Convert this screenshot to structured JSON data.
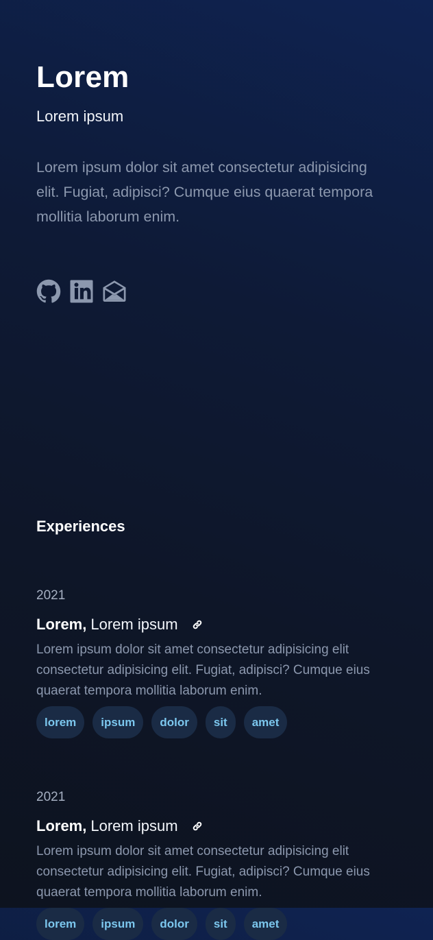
{
  "header": {
    "name": "Lorem",
    "subtitle": "Lorem ipsum",
    "intro": "Lorem ipsum dolor sit amet consectetur adipisicing elit. Fugiat, adipisci? Cumque eius quaerat tempora mollitia laborum enim."
  },
  "socials": [
    {
      "icon": "github-icon"
    },
    {
      "icon": "linkedin-icon"
    },
    {
      "icon": "mail-icon"
    }
  ],
  "colors": {
    "text_muted": "#8c98ae",
    "tag_text": "#7cc7ee",
    "tag_bg": "#1a2b45"
  },
  "experiences": {
    "title": "Experiences",
    "items": [
      {
        "year": "2021",
        "company": "Lorem,",
        "role": "Lorem ipsum",
        "link_icon": "link-icon",
        "description": "Lorem ipsum dolor sit amet consectetur adipisicing elit consectetur adipisicing elit. Fugiat, adipisci? Cumque eius quaerat tempora mollitia laborum enim.",
        "tags": [
          "lorem",
          "ipsum",
          "dolor",
          "sit",
          "amet"
        ]
      },
      {
        "year": "2021",
        "company": "Lorem,",
        "role": "Lorem ipsum",
        "link_icon": "link-icon",
        "description": "Lorem ipsum dolor sit amet consectetur adipisicing elit consectetur adipisicing elit. Fugiat, adipisci? Cumque eius quaerat tempora mollitia laborum enim.",
        "tags": [
          "lorem",
          "ipsum",
          "dolor",
          "sit",
          "amet"
        ]
      }
    ]
  }
}
